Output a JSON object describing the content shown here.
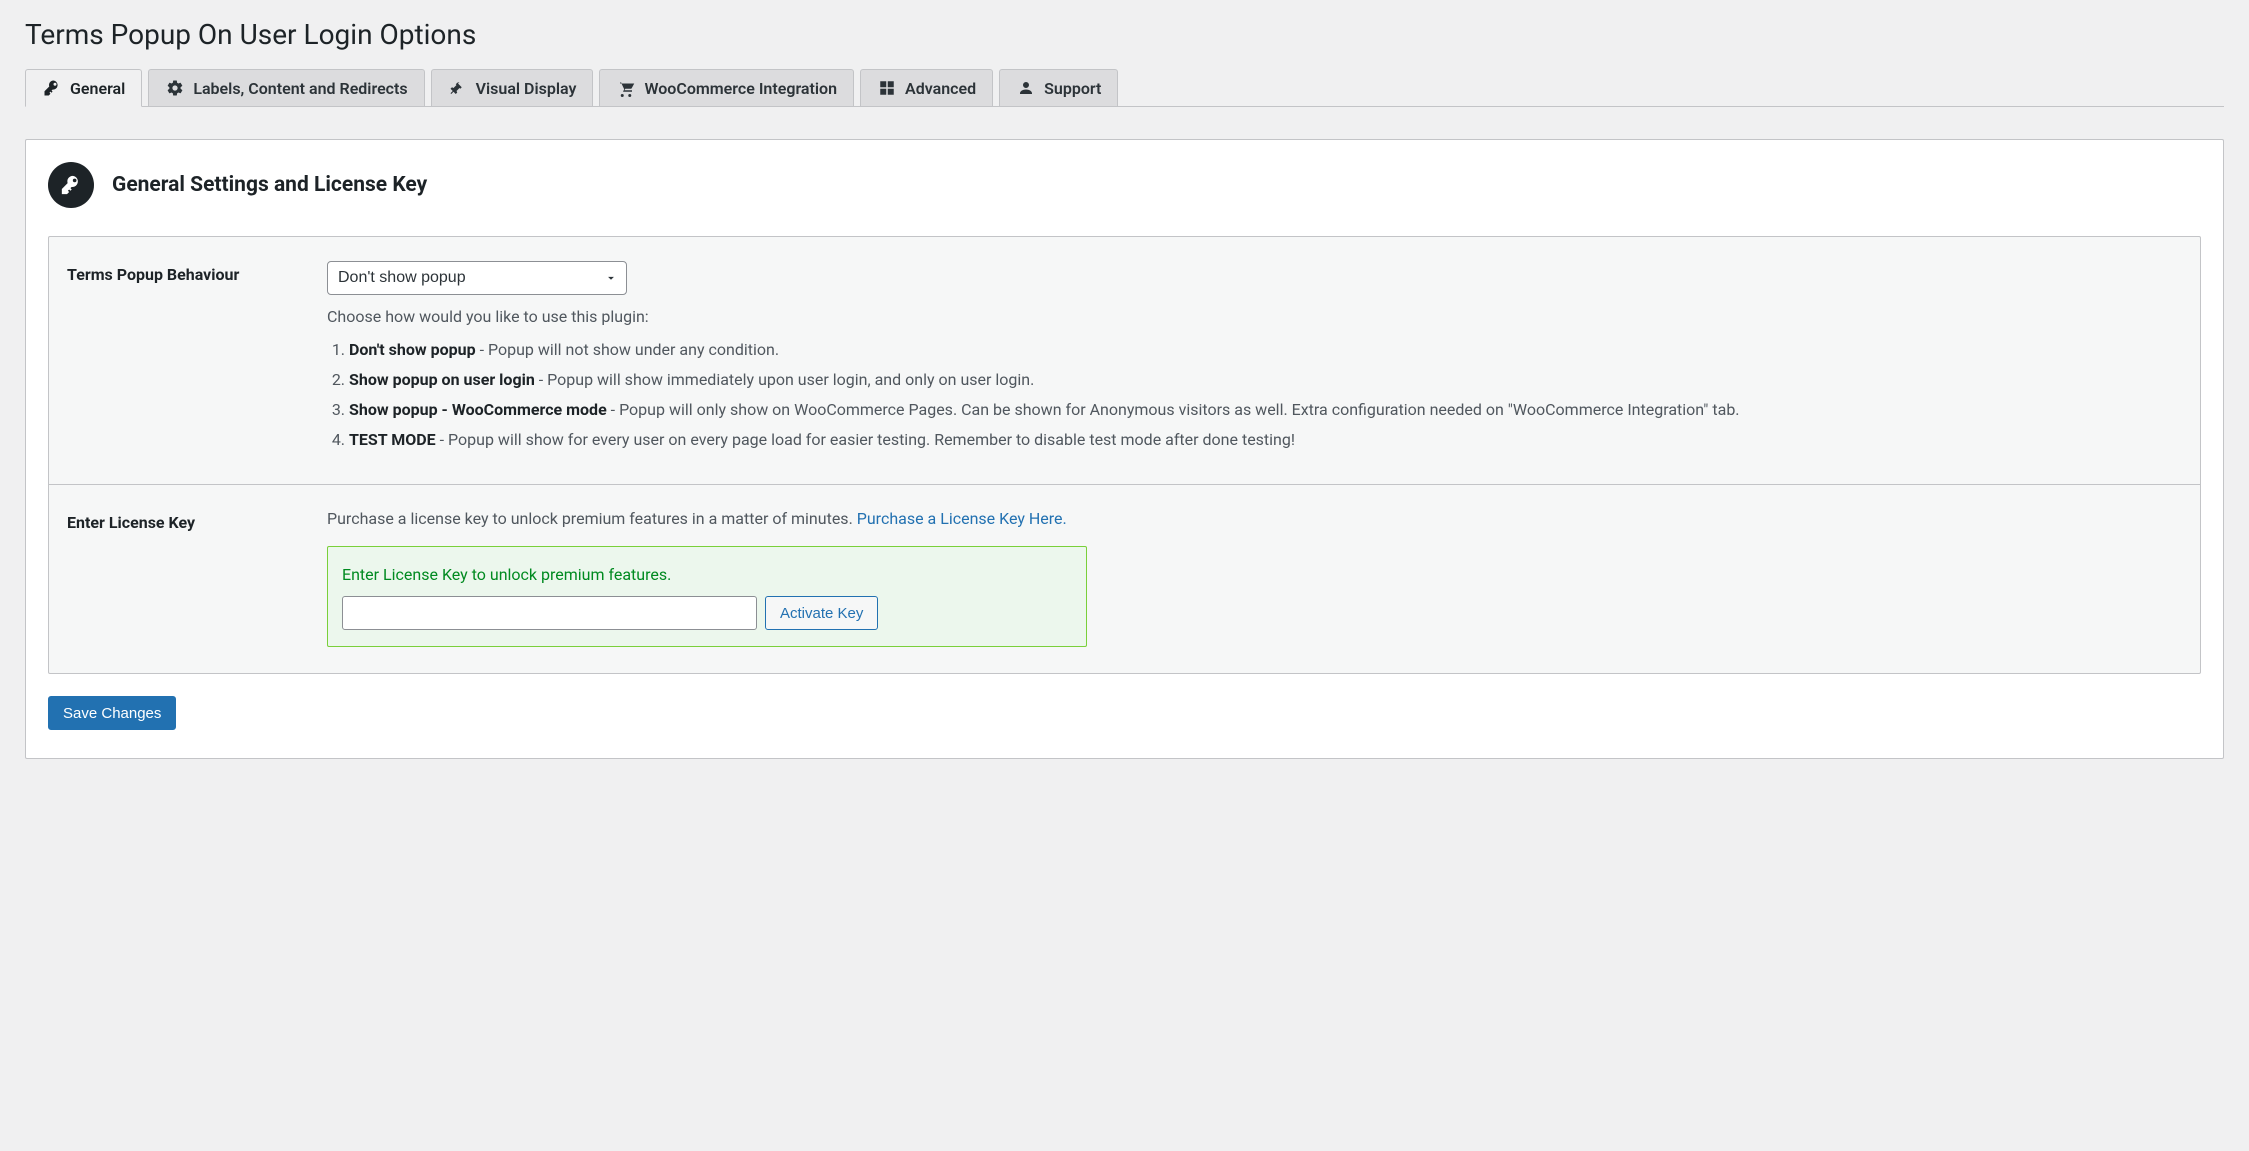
{
  "page_title": "Terms Popup On User Login Options",
  "tabs": [
    {
      "label": "General"
    },
    {
      "label": "Labels, Content and Redirects"
    },
    {
      "label": "Visual Display"
    },
    {
      "label": "WooCommerce Integration"
    },
    {
      "label": "Advanced"
    },
    {
      "label": "Support"
    }
  ],
  "section_heading": "General Settings and License Key",
  "behaviour": {
    "label": "Terms Popup Behaviour",
    "selected": "Don't show popup",
    "description": "Choose how would you like to use this plugin:",
    "options": [
      {
        "bold": "Don't show popup",
        "rest": " - Popup will not show under any condition."
      },
      {
        "bold": "Show popup on user login",
        "rest": " - Popup will show immediately upon user login, and only on user login."
      },
      {
        "bold": "Show popup - WooCommerce mode",
        "rest": " - Popup will only show on WooCommerce Pages. Can be shown for Anonymous visitors as well. Extra configuration needed on \"WooCommerce Integration\" tab."
      },
      {
        "bold": "TEST MODE",
        "rest": " - Popup will show for every user on every page load for easier testing. Remember to disable test mode after done testing!"
      }
    ]
  },
  "license": {
    "label": "Enter License Key",
    "purchase_intro": "Purchase a license key to unlock premium features in a matter of minutes. ",
    "purchase_link": "Purchase a License Key Here.",
    "hint": "Enter License Key to unlock premium features.",
    "value": "",
    "activate_label": "Activate Key"
  },
  "save_label": "Save Changes"
}
